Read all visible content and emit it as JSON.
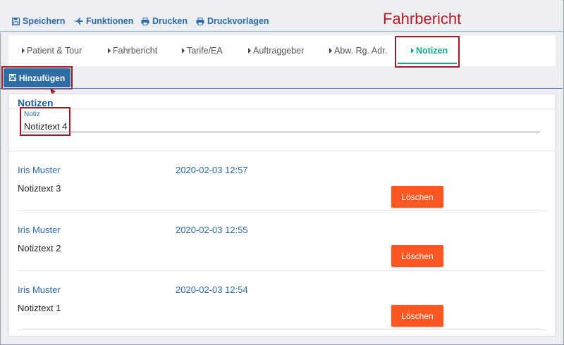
{
  "toolbar": {
    "save_label": "Speichern",
    "functions_label": "Funktionen",
    "print_label": "Drucken",
    "templates_label": "Druckvorlagen"
  },
  "banner_title": "Fahrbericht",
  "tabs": [
    {
      "label": "Patient & Tour"
    },
    {
      "label": "Fahrbericht"
    },
    {
      "label": "Tarife/EA"
    },
    {
      "label": "Auftraggeber"
    },
    {
      "label": "Abw. Rg. Adr."
    },
    {
      "label": "Notizen",
      "active": true
    }
  ],
  "add_button_label": "Hinzufügen",
  "panel": {
    "title": "Notizen",
    "field_label": "Notiz",
    "field_value": "Notiztext 4"
  },
  "entries": [
    {
      "author": "Iris Muster",
      "date": "2020-02-03 12:57",
      "text": "Notiztext 3",
      "delete_label": "Löschen"
    },
    {
      "author": "Iris Muster",
      "date": "2020-02-03 12:55",
      "text": "Notiztext 2",
      "delete_label": "Löschen"
    },
    {
      "author": "Iris Muster",
      "date": "2020-02-03 12:54",
      "text": "Notiztext 1",
      "delete_label": "Löschen"
    }
  ],
  "colors": {
    "accent": "#2a6aa8",
    "active_tab": "#14a88a",
    "delete": "#ff5722",
    "highlight": "#a21a26"
  }
}
